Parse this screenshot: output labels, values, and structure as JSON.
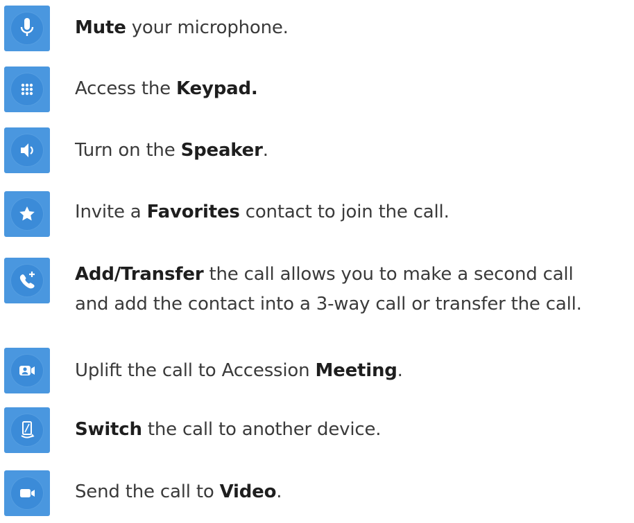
{
  "colors": {
    "tile_bg": "#4a97df",
    "tile_disc": "#3b8bd8",
    "icon_fg": "#ffffff",
    "text": "#3a3a3a",
    "bold_text": "#1e1e1e"
  },
  "rows": [
    {
      "icon": "microphone-icon",
      "bold": "Mute",
      "after": " your microphone.",
      "before": ""
    },
    {
      "icon": "keypad-icon",
      "before": "Access the ",
      "bold": "Keypad.",
      "after": ""
    },
    {
      "icon": "speaker-icon",
      "before": "Turn on the ",
      "bold": "Speaker",
      "after": "."
    },
    {
      "icon": "star-icon",
      "before": "Invite a ",
      "bold": "Favorites",
      "after": " contact to join the call."
    },
    {
      "icon": "add-call-icon",
      "before": "",
      "bold": "Add/Transfer",
      "after": " the call allows you to make a second call",
      "line2": "and add the contact into a 3-way call or transfer the call."
    },
    {
      "icon": "meeting-icon",
      "before": "Uplift the call to Accession ",
      "bold": "Meeting",
      "after": "."
    },
    {
      "icon": "switch-device-icon",
      "before": "",
      "bold": "Switch",
      "after": " the call to another device."
    },
    {
      "icon": "video-icon",
      "before": "Send the call to ",
      "bold": "Video",
      "after": "."
    }
  ]
}
